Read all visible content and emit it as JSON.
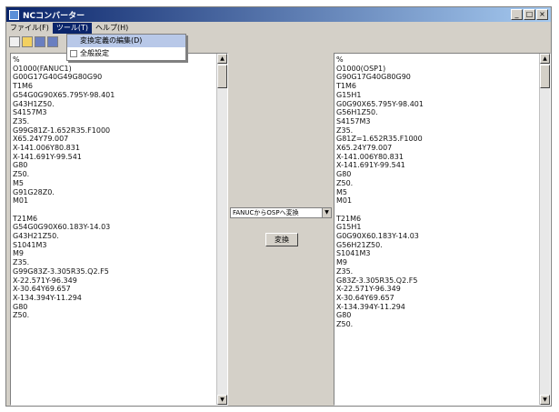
{
  "window": {
    "title": "NCコンバーター",
    "buttons": [
      "_",
      "□",
      "×"
    ]
  },
  "menu": {
    "items": [
      "ファイル(F)",
      "ツール(T)",
      "ヘルプ(H)"
    ],
    "active_index": 1
  },
  "dropdown": {
    "items": [
      "変換定義の編集(D)",
      "全般設定"
    ]
  },
  "converter": {
    "selected": "FANUCからOSPへ変換",
    "button": "変換"
  },
  "left_program": [
    "%",
    "O1000(FANUC1)",
    "G00G17G40G49G80G90",
    "T1M6",
    "G54G0G90X65.795Y-98.401",
    "G43H1Z50.",
    "S4157M3",
    "Z35.",
    "G99G81Z-1.652R35.F1000",
    "X65.24Y79.007",
    "X-141.006Y80.831",
    "X-141.691Y-99.541",
    "G80",
    "Z50.",
    "M5",
    "G91G28Z0.",
    "M01",
    "",
    "T21M6",
    "G54G0G90X60.183Y-14.03",
    "G43H21Z50.",
    "S1041M3",
    "M9",
    "Z35.",
    "G99G83Z-3.305R35.Q2.F5",
    "X-22.571Y-96.349",
    "X-30.64Y69.657",
    "X-134.394Y-11.294",
    "G80",
    "Z50."
  ],
  "right_program": [
    "%",
    "O1000(OSP1)",
    "G90G17G40G80G90",
    "T1M6",
    "G15H1",
    "G0G90X65.795Y-98.401",
    "G56H1Z50.",
    "S4157M3",
    "Z35.",
    "G81Z=1.652R35.F1000",
    "X65.24Y79.007",
    "X-141.006Y80.831",
    "X-141.691Y-99.541",
    "G80",
    "Z50.",
    "M5",
    "M01",
    "",
    "T21M6",
    "G15H1",
    "G0G90X60.183Y-14.03",
    "G56H21Z50.",
    "S1041M3",
    "M9",
    "Z35.",
    "G83Z-3.305R35.Q2.F5",
    "X-22.571Y-96.349",
    "X-30.64Y69.657",
    "X-134.394Y-11.294",
    "G80",
    "Z50."
  ]
}
